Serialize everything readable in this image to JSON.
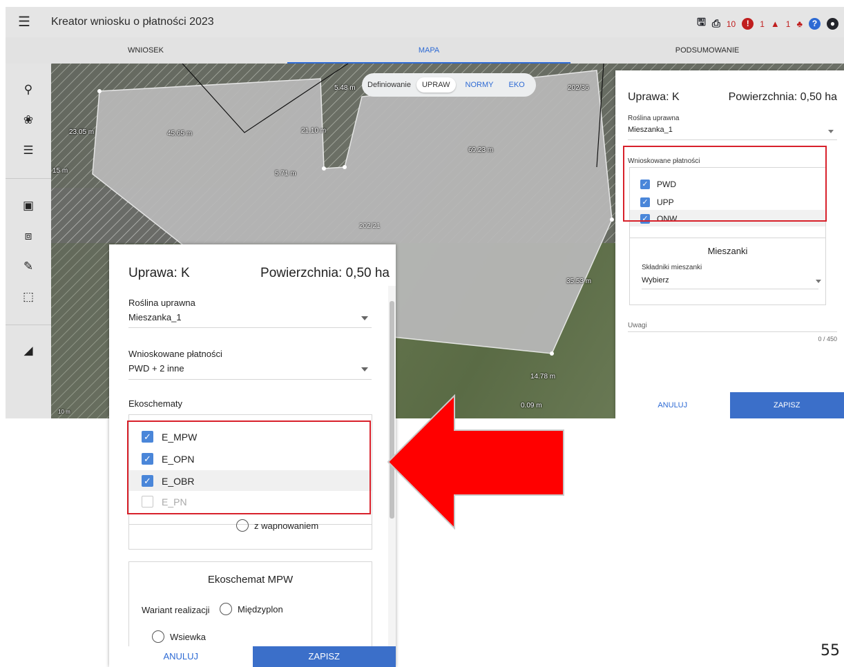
{
  "app": {
    "title": "Kreator wniosku o płatności 2023",
    "menu_icon": "hamburger-icon",
    "top_icons": {
      "save_icon": "save-icon",
      "print_icon": "print-icon",
      "errors_count": "10",
      "warnings_count": "1",
      "notifications_count": "1",
      "help_icon": "help-icon",
      "account_icon": "account-icon"
    }
  },
  "tabs": [
    {
      "label": "WNIOSEK"
    },
    {
      "label": "MAPA"
    },
    {
      "label": "PODSUMOWANIE"
    }
  ],
  "sidebar": [
    "search-icon",
    "plant-icon",
    "list-icon",
    "select-area-icon",
    "layers-icon",
    "pencil-icon",
    "crop-icon",
    "ruler-icon"
  ],
  "map": {
    "mode_label": "Definiowanie",
    "modes": [
      "UPRAW",
      "NORMY",
      "EKO"
    ],
    "selected_mode": "UPRAW",
    "measurements": [
      "23.05 m",
      "45.65 m",
      "21.10 m",
      "5.48 m",
      "69.23 m",
      "5.71 m",
      "35.53 m",
      "14.78 m",
      "0.09 m",
      "15 m"
    ],
    "parcel_labels": [
      "202/36",
      "202/21"
    ],
    "scale_label": "10 m"
  },
  "right_panel": {
    "title": "Uprawa: K",
    "area": "Powierzchnia: 0,50 ha",
    "crop_label": "Roślina uprawna",
    "crop_value": "Mieszanka_1",
    "payments_label": "Wnioskowane płatności",
    "payments": [
      {
        "label": "PWD",
        "checked": true
      },
      {
        "label": "UPP",
        "checked": true
      },
      {
        "label": "ONW",
        "checked": true
      }
    ],
    "mixtures_title": "Mieszanki",
    "mixture_components_label": "Składniki mieszanki",
    "mixture_components_value": "Wybierz",
    "notes_label": "Uwagi",
    "notes_counter": "0 / 450",
    "cancel": "ANULUJ",
    "save": "ZAPISZ"
  },
  "dialog": {
    "title": "Uprawa: K",
    "area": "Powierzchnia: 0,50 ha",
    "crop_label": "Roślina uprawna",
    "crop_value": "Mieszanka_1",
    "payments_label": "Wnioskowane płatności",
    "payments_value": "PWD + 2 inne",
    "ecoschemes_label": "Ekoschematy",
    "ecoschemes": [
      {
        "label": "E_MPW",
        "checked": true
      },
      {
        "label": "E_OPN",
        "checked": true
      },
      {
        "label": "E_OBR",
        "checked": true
      },
      {
        "label": "E_PN",
        "checked": false
      }
    ],
    "liming_option": "z wapnowaniem",
    "mpw_title": "Ekoschemat MPW",
    "variant_label": "Wariant realizacji",
    "variant_options": [
      "Międzyplon",
      "Wsiewka"
    ],
    "cancel": "ANULUJ",
    "save": "ZAPISZ"
  },
  "page_number": "55",
  "colors": {
    "accent": "#2d6ad4",
    "highlight_box": "#d8202a",
    "arrow": "#ff0000",
    "error": "#c01e1e"
  }
}
